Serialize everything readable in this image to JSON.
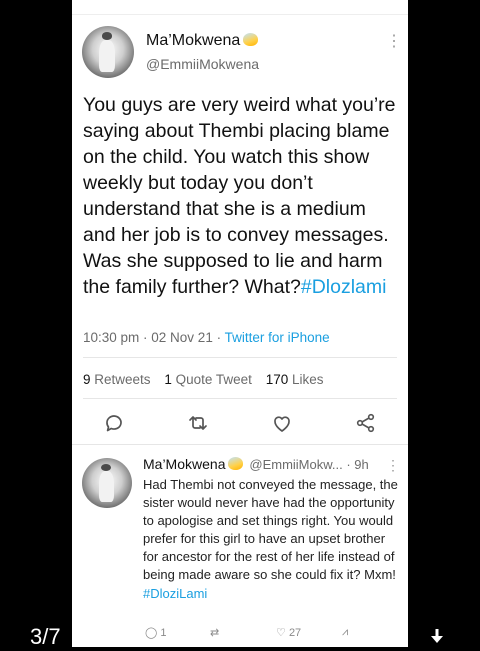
{
  "tweet": {
    "author_name": "Ma’Mokwena",
    "author_handle": "@EmmiiMokwena",
    "text": "You guys are very weird what you’re saying about Thembi placing blame on the child. You watch this show weekly but today you don’t understand that she is a medium and her job is to convey messages. Was she supposed to lie and harm the family further? What?",
    "hashtag": "#Dlozlami",
    "time": "10:30 pm · 02 Nov 21 · ",
    "source": "Twitter for iPhone",
    "retweets_count": "9",
    "retweets_label": "Retweets",
    "quote_count": "1",
    "quote_label": "Quote Tweet",
    "likes_count": "170",
    "likes_label": "Likes"
  },
  "reply": {
    "author_name": "Ma’Mokwena",
    "handle_time": "@EmmiiMokw... · 9h",
    "text": "Had Thembi not conveyed the message, the sister would never have had the opportunity to apologise and set things right. You would prefer for this girl to have an upset brother for ancestor for the rest of her life instead of being made aware so she could fix it? Mxm!",
    "hashtag": "#DloziLami",
    "reply_count": "1",
    "like_count": "27"
  },
  "viewer": {
    "page_indicator": "3/7"
  },
  "colors": {
    "link": "#1a9fe0",
    "text": "#111111",
    "muted": "#6b6b6b"
  }
}
